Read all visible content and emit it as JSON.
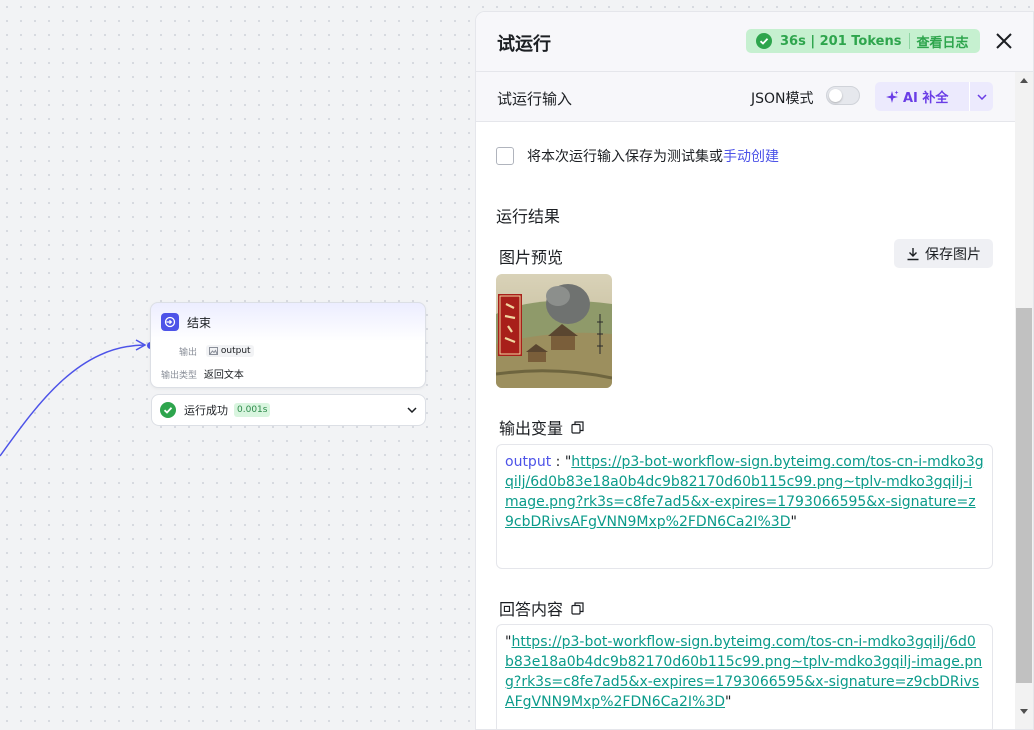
{
  "canvas": {
    "end_node": {
      "title": "结束",
      "output_label": "输出",
      "output_var": "output",
      "output_type_label": "输出类型",
      "output_type_value": "返回文本"
    },
    "status": {
      "text": "运行成功",
      "time": "0.001s"
    }
  },
  "panel": {
    "title": "试运行",
    "run_badge": {
      "summary": "36s | 201 Tokens",
      "log_label": "查看日志"
    },
    "input_bar": {
      "title": "试运行输入",
      "json_mode_label": "JSON模式",
      "json_mode_on": false,
      "ai_label": "AI 补全"
    },
    "save_testset": {
      "text": "将本次运行输入保存为测试集或",
      "link": "手动创建"
    },
    "result_title": "运行结果",
    "preview": {
      "title": "图片预览",
      "save_button": "保存图片"
    },
    "output": {
      "title": "输出变量",
      "key": "output",
      "sep": " : ",
      "url": "https://p3-bot-workflow-sign.byteimg.com/tos-cn-i-mdko3gqilj/6d0b83e18a0b4dc9b82170d60b115c99.png~tplv-mdko3gqilj-image.png?rk3s=c8fe7ad5&x-expires=1793066595&x-signature=z9cbDRivsAFgVNN9Mxp%2FDN6Ca2I%3D"
    },
    "answer": {
      "title": "回答内容",
      "url": "https://p3-bot-workflow-sign.byteimg.com/tos-cn-i-mdko3gqilj/6d0b83e18a0b4dc9b82170d60b115c99.png~tplv-mdko3gqilj-image.png?rk3s=c8fe7ad5&x-expires=1793066595&x-signature=z9cbDRivsAFgVNN9Mxp%2FDN6Ca2I%3D"
    },
    "quote": "\""
  },
  "colors": {
    "accent": "#4d53e8",
    "success": "#2ea54d",
    "link_teal": "#0b9b8a",
    "ai_purple": "#6a3de6"
  },
  "icons": [
    "end-node-icon",
    "image-icon",
    "check-circle-icon",
    "chevron-down-icon",
    "close-icon",
    "sparkle-icon",
    "download-icon",
    "copy-icon"
  ]
}
